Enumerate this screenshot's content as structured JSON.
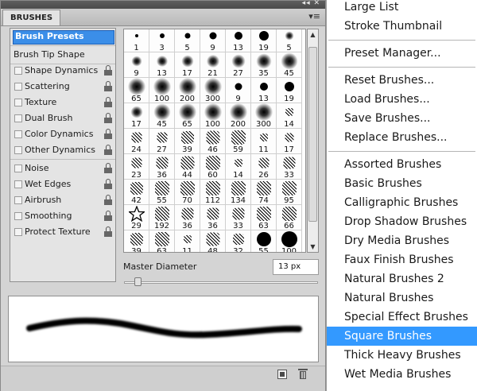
{
  "panel": {
    "tab_title": "BRUSHES",
    "window_controls": "◂◂ ✕",
    "menu_glyph": "▾≡"
  },
  "options": [
    {
      "label": "Brush Presets",
      "type": "header",
      "selected": true
    },
    {
      "label": "Brush Tip Shape",
      "type": "plain"
    },
    {
      "label": "Shape Dynamics",
      "type": "check",
      "lock": true
    },
    {
      "label": "Scattering",
      "type": "check",
      "lock": true
    },
    {
      "label": "Texture",
      "type": "check",
      "lock": true
    },
    {
      "label": "Dual Brush",
      "type": "check",
      "lock": true
    },
    {
      "label": "Color Dynamics",
      "type": "check",
      "lock": true
    },
    {
      "label": "Other Dynamics",
      "type": "check",
      "lock": true
    },
    {
      "label": "Noise",
      "type": "check",
      "lock": true
    },
    {
      "label": "Wet Edges",
      "type": "check",
      "lock": true
    },
    {
      "label": "Airbrush",
      "type": "check",
      "lock": true
    },
    {
      "label": "Smoothing",
      "type": "check",
      "lock": true
    },
    {
      "label": "Protect Texture",
      "type": "check",
      "lock": true
    }
  ],
  "brush_grid": [
    [
      "1",
      "3",
      "5",
      "9",
      "13",
      "19",
      "5"
    ],
    [
      "9",
      "13",
      "17",
      "21",
      "27",
      "35",
      "45"
    ],
    [
      "65",
      "100",
      "200",
      "300",
      "9",
      "13",
      "19"
    ],
    [
      "17",
      "45",
      "65",
      "100",
      "200",
      "300",
      "14"
    ],
    [
      "24",
      "27",
      "39",
      "46",
      "59",
      "11",
      "17"
    ],
    [
      "23",
      "36",
      "44",
      "60",
      "14",
      "26",
      "33"
    ],
    [
      "42",
      "55",
      "70",
      "112",
      "134",
      "74",
      "95"
    ],
    [
      "29",
      "192",
      "36",
      "36",
      "33",
      "63",
      "66"
    ],
    [
      "39",
      "63",
      "11",
      "48",
      "32",
      "55",
      "100"
    ]
  ],
  "brush_tip_kinds": [
    [
      "hard",
      "hard",
      "hard",
      "hard",
      "hard",
      "hard",
      "soft"
    ],
    [
      "soft",
      "soft",
      "soft",
      "soft",
      "soft",
      "soft",
      "soft"
    ],
    [
      "soft",
      "soft",
      "soft",
      "soft",
      "hard",
      "hard",
      "hard"
    ],
    [
      "soft",
      "soft",
      "soft",
      "soft",
      "soft",
      "soft",
      "tex"
    ],
    [
      "tex",
      "tex",
      "tex",
      "tex",
      "tex",
      "tex",
      "tex"
    ],
    [
      "tex",
      "tex",
      "tex",
      "tex",
      "tex",
      "tex",
      "tex"
    ],
    [
      "tex",
      "tex",
      "tex",
      "tex",
      "tex",
      "tex",
      "tex"
    ],
    [
      "star",
      "tex",
      "tex",
      "tex",
      "tex",
      "tex",
      "tex"
    ],
    [
      "tex",
      "tex",
      "tex",
      "tex",
      "tex",
      "hard",
      "hard"
    ]
  ],
  "master_diameter": {
    "label": "Master Diameter",
    "value": "13 px",
    "slider_fraction": 0.07
  },
  "menu": {
    "items": [
      {
        "label": "Large List"
      },
      {
        "label": "Stroke Thumbnail"
      },
      {
        "sep": true
      },
      {
        "label": "Preset Manager..."
      },
      {
        "sep": true
      },
      {
        "label": "Reset Brushes..."
      },
      {
        "label": "Load Brushes..."
      },
      {
        "label": "Save Brushes..."
      },
      {
        "label": "Replace Brushes..."
      },
      {
        "sep": true
      },
      {
        "label": "Assorted Brushes"
      },
      {
        "label": "Basic Brushes"
      },
      {
        "label": "Calligraphic Brushes"
      },
      {
        "label": "Drop Shadow Brushes"
      },
      {
        "label": "Dry Media Brushes"
      },
      {
        "label": "Faux Finish Brushes"
      },
      {
        "label": "Natural Brushes 2"
      },
      {
        "label": "Natural Brushes"
      },
      {
        "label": "Special Effect Brushes"
      },
      {
        "label": "Square Brushes",
        "active": true
      },
      {
        "label": "Thick Heavy Brushes"
      },
      {
        "label": "Wet Media Brushes"
      }
    ]
  },
  "colors": {
    "selection_blue": "#3399ff",
    "panel_gray": "#d4d4d4"
  }
}
